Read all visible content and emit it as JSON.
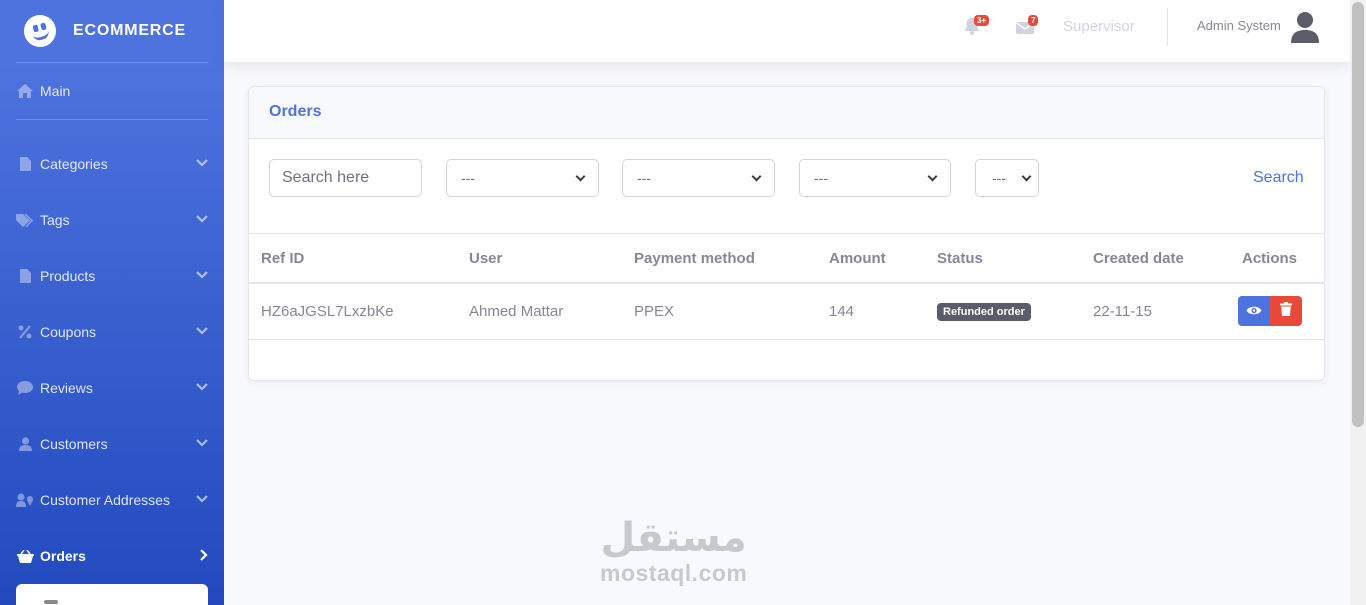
{
  "brand": {
    "name": "ECOMMERCE"
  },
  "sidebar": {
    "main": {
      "label": "Main",
      "icon": "home-icon"
    },
    "items": [
      {
        "label": "Categories",
        "icon": "file-icon"
      },
      {
        "label": "Tags",
        "icon": "tags-icon"
      },
      {
        "label": "Products",
        "icon": "file-icon"
      },
      {
        "label": "Coupons",
        "icon": "percent-icon"
      },
      {
        "label": "Reviews",
        "icon": "comment-icon"
      },
      {
        "label": "Customers",
        "icon": "user-icon"
      },
      {
        "label": "Customer Addresses",
        "icon": "map-marker-icon"
      },
      {
        "label": "Orders",
        "icon": "shopping-basket-icon",
        "active": true
      }
    ]
  },
  "topbar": {
    "alerts_badge": "3+",
    "messages_badge": "7",
    "role": "Supervisor",
    "user_name": "Admin System"
  },
  "card": {
    "title": "Orders"
  },
  "filters": {
    "search_placeholder": "Search here",
    "selects": [
      "---",
      "---",
      "---",
      "---"
    ],
    "search_label": "Search"
  },
  "table": {
    "headers": [
      "Ref ID",
      "User",
      "Payment method",
      "Amount",
      "Status",
      "Created date",
      "Actions"
    ],
    "rows": [
      {
        "ref_id": "HZ6aJGSL7LxzbKe",
        "user": "Ahmed Mattar",
        "payment_method": "PPEX",
        "amount": "144",
        "status": "Refunded order",
        "created_date": "22-11-15"
      }
    ]
  },
  "watermark": {
    "arabic": "مستقل",
    "latin": "mostaql.com"
  },
  "colors": {
    "primary": "#4e73df",
    "danger": "#e74a3b",
    "dark_badge": "#5a5c69"
  }
}
